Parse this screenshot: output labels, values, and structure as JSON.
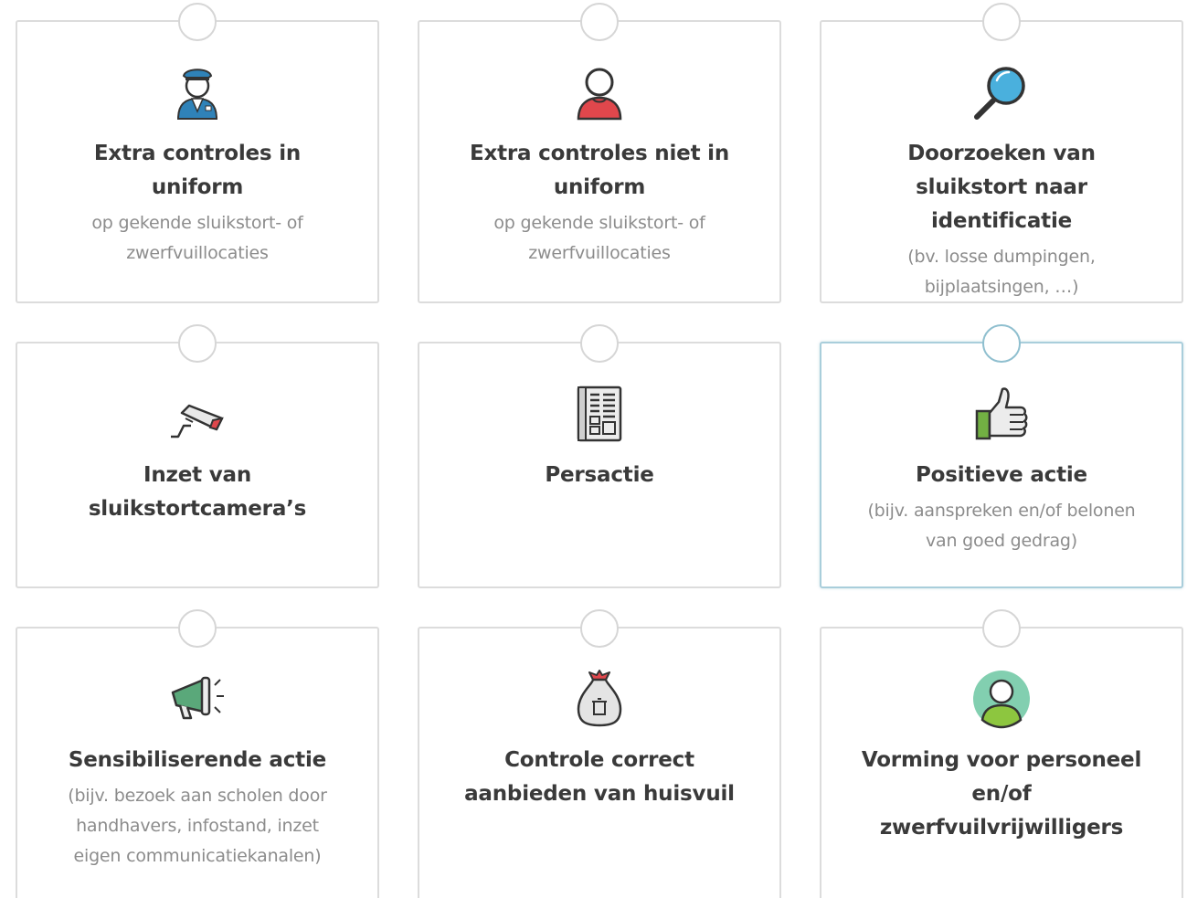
{
  "cards": [
    {
      "title": "Extra controles in uniform",
      "subtitle": "op gekende sluikstort- of zwerfvuillocaties",
      "icon": "police-officer-icon",
      "selected": false
    },
    {
      "title": "Extra controles niet in uniform",
      "subtitle": "op gekende sluikstort- of zwerfvuillocaties",
      "icon": "person-icon",
      "selected": false
    },
    {
      "title": "Doorzoeken van sluikstort naar identificatie",
      "subtitle": "(bv. losse dumpingen, bijplaatsingen, …)",
      "icon": "magnifier-icon",
      "selected": false
    },
    {
      "title": "Inzet van sluikstortcamera’s",
      "subtitle": "",
      "icon": "security-camera-icon",
      "selected": false
    },
    {
      "title": "Persactie",
      "subtitle": "",
      "icon": "newspaper-icon",
      "selected": false
    },
    {
      "title": "Positieve actie",
      "subtitle": "(bijv. aanspreken en/of belonen van goed gedrag)",
      "icon": "thumbs-up-icon",
      "selected": true
    },
    {
      "title": "Sensibiliserende actie",
      "subtitle": "(bijv. bezoek aan scholen door handhavers, infostand, inzet eigen communicatiekanalen)",
      "icon": "megaphone-icon",
      "selected": false
    },
    {
      "title": "Controle correct aanbieden van huisvuil",
      "subtitle": "",
      "icon": "garbage-bag-icon",
      "selected": false
    },
    {
      "title": "Vorming voor personeel en/of zwerfvuilvrijwilligers",
      "subtitle": "",
      "icon": "trainee-avatar-icon",
      "selected": false
    }
  ],
  "colors": {
    "border": "#dcdcdc",
    "selected_border": "#a9cedb",
    "title": "#3a3a3a",
    "subtitle": "#8c8c8c",
    "police_blue": "#2f82b8",
    "person_red": "#e0474c",
    "lens_blue": "#4ab0dd",
    "camera_red": "#e0474c",
    "thumb_green": "#72b043",
    "megaphone_green": "#5aa87a",
    "avatar_bg": "#82cfb0",
    "avatar_shirt": "#8dc63f"
  }
}
